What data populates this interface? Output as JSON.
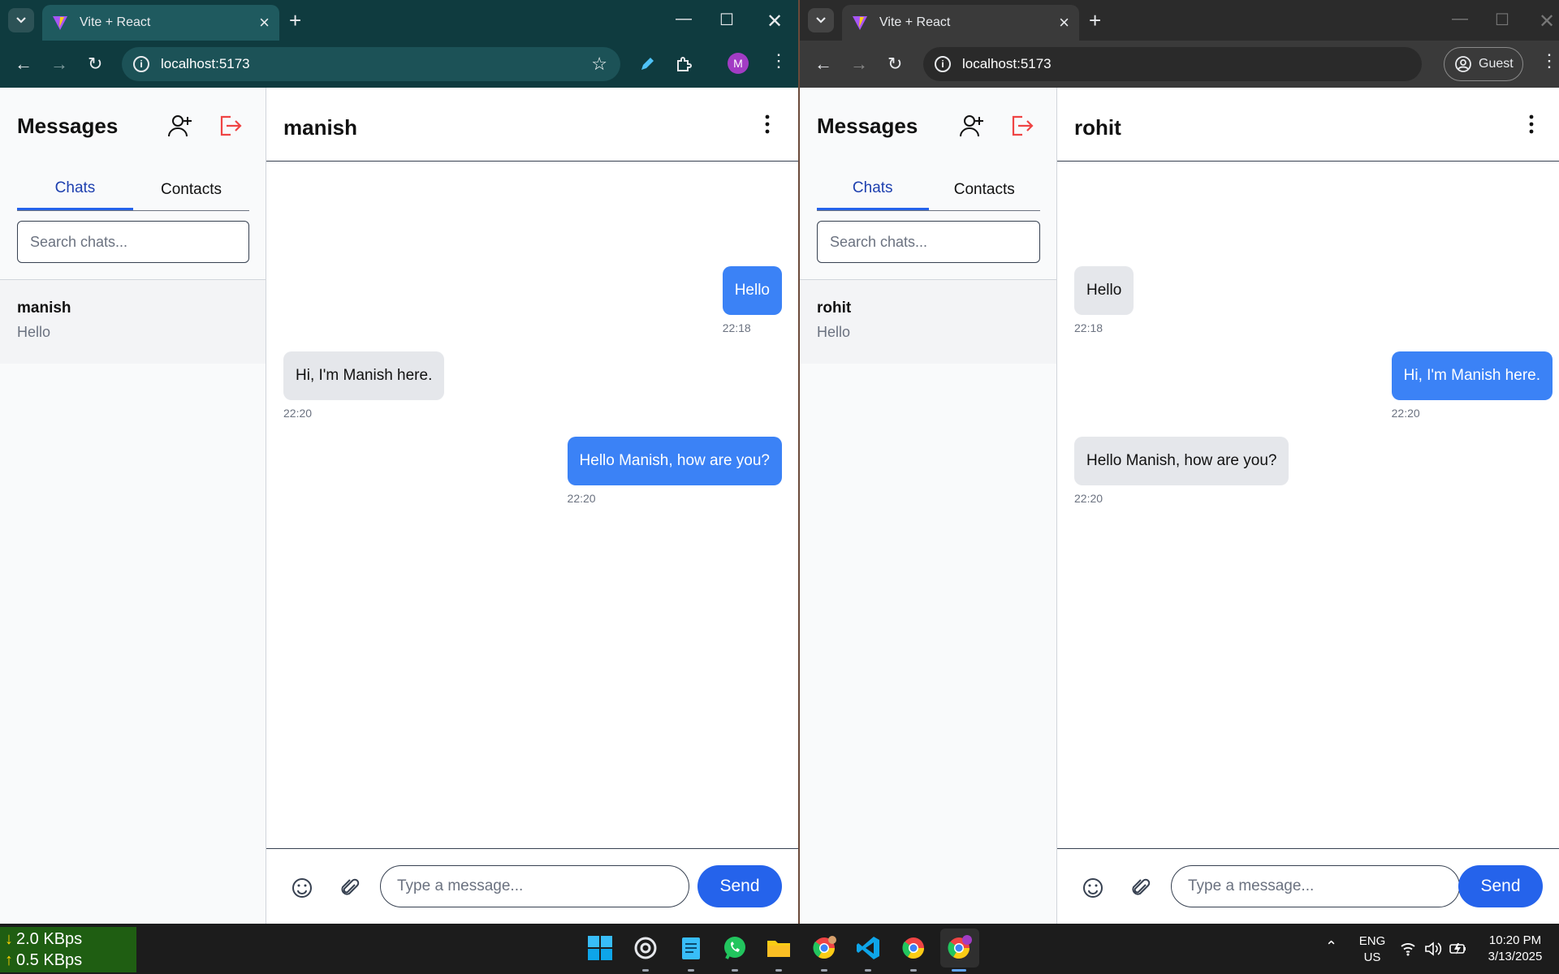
{
  "left_window": {
    "tab_title": "Vite + React",
    "url": "localhost:5173",
    "profile_initial": "M",
    "app": {
      "sidebar_title": "Messages",
      "tabs": [
        "Chats",
        "Contacts"
      ],
      "search_placeholder": "Search chats...",
      "chat_list": [
        {
          "name": "manish",
          "preview": "Hello"
        }
      ],
      "chat_header": "manish",
      "messages": [
        {
          "text": "Hello",
          "time": "22:18",
          "direction": "outgoing"
        },
        {
          "text": "Hi, I'm Manish here.",
          "time": "22:20",
          "direction": "incoming"
        },
        {
          "text": "Hello Manish, how are you?",
          "time": "22:20",
          "direction": "outgoing"
        }
      ],
      "composer_placeholder": "Type a message...",
      "send_label": "Send"
    }
  },
  "right_window": {
    "tab_title": "Vite + React",
    "url": "localhost:5173",
    "profile_label": "Guest",
    "app": {
      "sidebar_title": "Messages",
      "tabs": [
        "Chats",
        "Contacts"
      ],
      "search_placeholder": "Search chats...",
      "chat_list": [
        {
          "name": "rohit",
          "preview": "Hello"
        }
      ],
      "chat_header": "rohit",
      "messages": [
        {
          "text": "Hello",
          "time": "22:18",
          "direction": "incoming"
        },
        {
          "text": "Hi, I'm Manish here.",
          "time": "22:20",
          "direction": "outgoing"
        },
        {
          "text": "Hello Manish, how are you?",
          "time": "22:20",
          "direction": "incoming"
        }
      ],
      "composer_placeholder": "Type a message...",
      "send_label": "Send"
    }
  },
  "taskbar": {
    "net_down": "2.0 KBps",
    "net_up": "0.5 KBps",
    "lang_line1": "ENG",
    "lang_line2": "US",
    "time": "10:20 PM",
    "date": "3/13/2025",
    "pinned_icons": [
      "windows-start-icon",
      "chatgpt-icon",
      "notepad-icon",
      "whatsapp-icon",
      "file-explorer-icon",
      "chrome-profile-icon",
      "vscode-icon",
      "chrome-icon",
      "chrome-active-icon"
    ]
  },
  "colors": {
    "accent_blue": "#3b82f6",
    "send_blue": "#2563eb",
    "logout_red": "#ef4444",
    "incoming_bubble": "#e5e7eb"
  }
}
